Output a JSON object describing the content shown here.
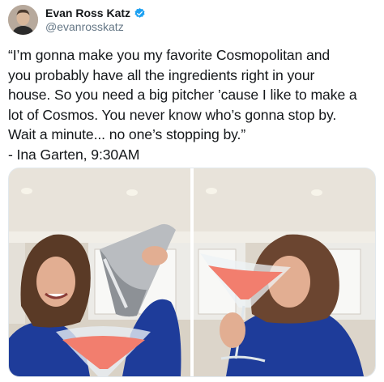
{
  "author": {
    "display_name": "Evan Ross Katz",
    "handle": "@evanrosskatz",
    "verified": true,
    "avatar_icon": "profile-photo"
  },
  "tweet": {
    "lines": [
      "“I’m gonna make you my favorite Cosmopolitan and",
      "you probably have all the ingredients right in your",
      "house. So you need a big pitcher ’cause I like to make a",
      "lot of Cosmos. You never know who’s gonna stop by.",
      "Wait a minute... no one’s stopping by.”",
      "- Ina Garten, 9:30AM"
    ]
  },
  "media": {
    "photos": [
      {
        "subject": "woman-pouring-cocktail-shaker"
      },
      {
        "subject": "woman-sipping-cosmopolitan"
      }
    ]
  },
  "colors": {
    "text": "#14171a",
    "secondary_text": "#657786",
    "verified_badge": "#1da1f2",
    "border": "#e1e8ed",
    "cosmo_pink": "#f27e6e",
    "shirt_blue": "#1e3c9a"
  }
}
